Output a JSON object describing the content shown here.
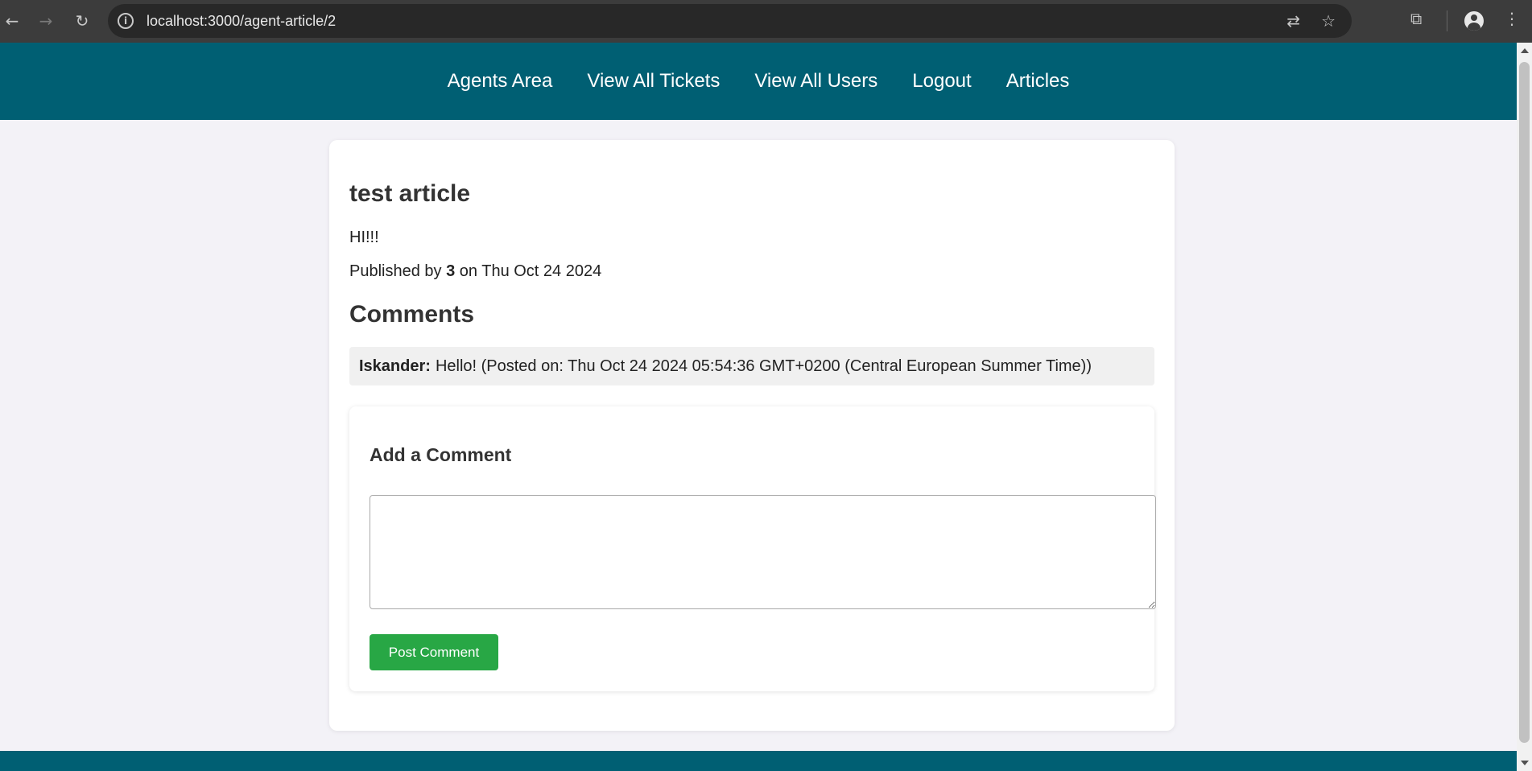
{
  "browser": {
    "url": "localhost:3000/agent-article/2",
    "back_icon": "arrow-left",
    "forward_icon": "arrow-right",
    "reload_icon": "reload",
    "translate_icon": "translate",
    "bookmark_icon": "star",
    "extensions_icon": "puzzle",
    "profile_icon": "person",
    "menu_icon": "kebab"
  },
  "nav": {
    "items": [
      "Agents Area",
      "View All Tickets",
      "View All Users",
      "Logout",
      "Articles"
    ]
  },
  "article": {
    "title": "test article",
    "content": "HI!!!",
    "published_prefix": "Published by",
    "author": "3",
    "published_suffix": "on Thu Oct 24 2024"
  },
  "comments": {
    "heading": "Comments",
    "items": [
      {
        "author": "Iskander:",
        "text": "Hello! (Posted on: Thu Oct 24 2024 05:54:36 GMT+0200 (Central European Summer Time))"
      }
    ]
  },
  "add_comment": {
    "heading": "Add a Comment",
    "textarea_value": "",
    "button_label": "Post Comment"
  },
  "colors": {
    "header_bg": "#005f73",
    "button_bg": "#28a745",
    "page_bg": "#f3f2f7"
  }
}
